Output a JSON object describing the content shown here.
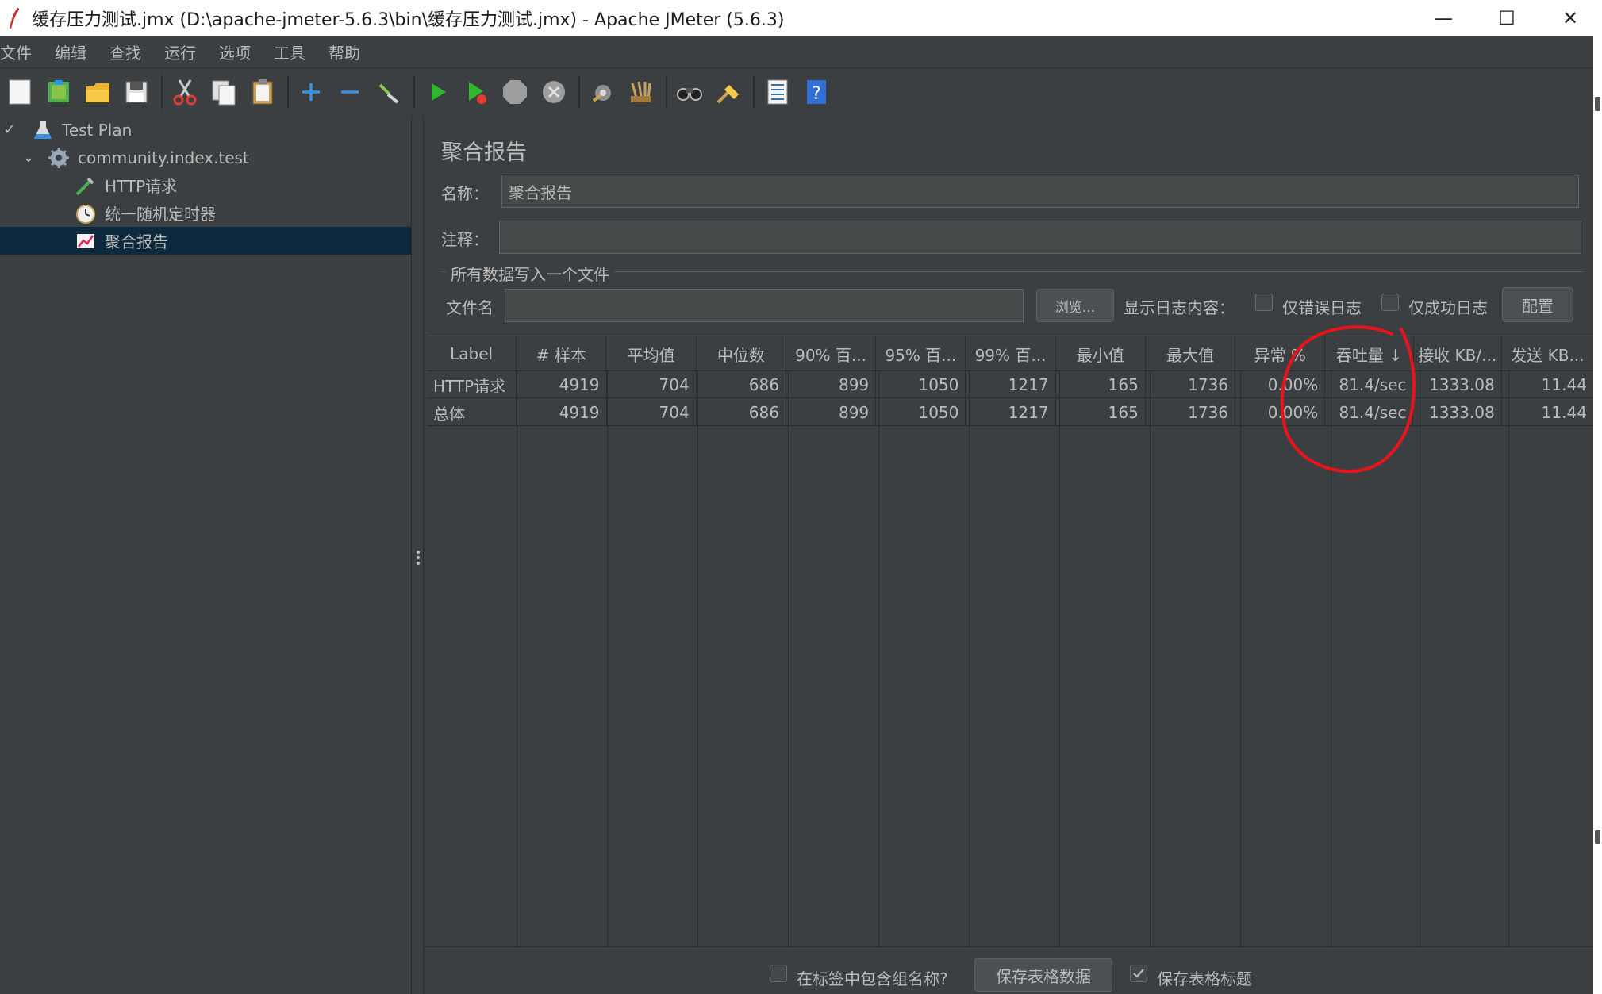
{
  "window": {
    "title": "缓存压力测试.jmx (D:\\apache-jmeter-5.6.3\\bin\\缓存压力测试.jmx) - Apache JMeter (5.6.3)",
    "minimize": "—",
    "maximize": "☐",
    "close": "✕"
  },
  "menu": [
    "文件",
    "编辑",
    "查找",
    "运行",
    "选项",
    "工具",
    "帮助"
  ],
  "toolbar": {
    "icons": [
      "new-icon",
      "templates-icon",
      "open-icon",
      "save-icon",
      "cut-icon",
      "copy-icon",
      "paste-icon",
      "expand-icon",
      "collapse-icon",
      "toggle-icon",
      "start-icon",
      "start-no-pause-icon",
      "stop-icon",
      "shutdown-icon",
      "clear-icon",
      "clear-all-icon",
      "search-icon",
      "reset-search-icon",
      "function-helper-icon",
      "help-icon"
    ]
  },
  "tree": {
    "items": [
      {
        "label": "Test Plan",
        "icon": "flask-icon"
      },
      {
        "label": "community.index.test",
        "icon": "gear-icon"
      },
      {
        "label": "HTTP请求",
        "icon": "pipette-icon"
      },
      {
        "label": "统一随机定时器",
        "icon": "timer-icon"
      },
      {
        "label": "聚合报告",
        "icon": "report-chart-icon"
      }
    ]
  },
  "panel": {
    "title": "聚合报告",
    "name_label": "名称：",
    "name_value": "聚合报告",
    "comment_label": "注释：",
    "comment_value": "",
    "file_group_label": "所有数据写入一个文件",
    "filename_label": "文件名",
    "filename_value": "",
    "browse_button": "浏览...",
    "log_content_label": "显示日志内容：",
    "errors_only_label": "仅错误日志",
    "success_only_label": "仅成功日志",
    "configure_button": "配置"
  },
  "table": {
    "columns": [
      "Label",
      "# 样本",
      "平均值",
      "中位数",
      "90% 百...",
      "95% 百...",
      "99% 百...",
      "最小值",
      "最大值",
      "异常 %",
      "吞吐量 ↓",
      "接收 KB/...",
      "发送 KB..."
    ],
    "rows": [
      [
        "HTTP请求",
        "4919",
        "704",
        "686",
        "899",
        "1050",
        "1217",
        "165",
        "1736",
        "0.00%",
        "81.4/sec",
        "1333.08",
        "11.44"
      ],
      [
        "总体",
        "4919",
        "704",
        "686",
        "899",
        "1050",
        "1217",
        "165",
        "1736",
        "0.00%",
        "81.4/sec",
        "1333.08",
        "11.44"
      ]
    ]
  },
  "footer": {
    "include_group_label": "在标签中包含组名称?",
    "save_table_button": "保存表格数据",
    "save_header_label": "保存表格标题",
    "save_header_checked": true
  },
  "colors": {
    "background": "#3c3f41",
    "selected": "#0d293e",
    "text": "#bbbbbb",
    "annotation": "#e8141c"
  }
}
